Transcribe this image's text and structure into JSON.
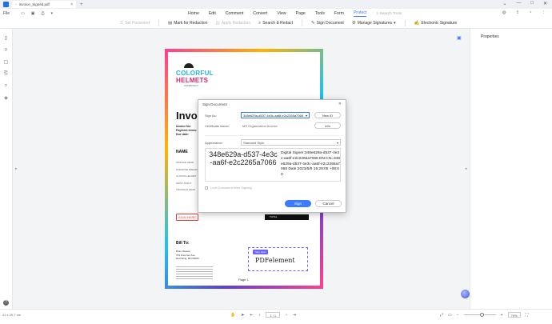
{
  "titlebar": {
    "tab_title": "invoice_Signed.pdf",
    "close_glyph": "×",
    "add_tab_glyph": "+",
    "window_controls": [
      "⌄",
      "—",
      "□",
      "✕"
    ]
  },
  "menubar": {
    "file_label": "File",
    "items": [
      "Home",
      "Edit",
      "Comment",
      "Convert",
      "View",
      "Page",
      "Tools",
      "Form",
      "Protect"
    ],
    "active_index": 8,
    "search_placeholder": "Search Tools"
  },
  "toolbar": {
    "items": [
      {
        "label": "Set Password",
        "disabled": true,
        "icon": "lock-icon"
      },
      {
        "label": "Mark for Redaction",
        "disabled": false,
        "icon": "redact-icon"
      },
      {
        "label": "Apply Redaction",
        "disabled": true,
        "icon": "apply-redaction-icon"
      },
      {
        "label": "Search & Redact",
        "disabled": false,
        "icon": "search-redact-icon"
      },
      {
        "label": "Sign Document",
        "disabled": false,
        "icon": "sign-icon"
      },
      {
        "label": "Manage Signatures",
        "disabled": false,
        "icon": "manage-signatures-icon"
      },
      {
        "label": "Electronic Signature",
        "disabled": false,
        "icon": "esign-icon"
      }
    ]
  },
  "properties": {
    "title": "Properties"
  },
  "page": {
    "brand_line1": "COLORFUL",
    "brand_line2": "HELMETS",
    "brand_line3": "COMPANY",
    "invoice_title": "Invo",
    "meta_lines": [
      "Invoice No:",
      "Payment terms:",
      "Due date:"
    ],
    "name_heading": "NAME",
    "name_rows": [
      "ORANGE HEAD",
      "PARADISE DREAM",
      "CLOUDS HELMET",
      "SHINY NIGHT",
      "TRIANGLE HEAD"
    ],
    "sign_here_tag": "SIGN HERE",
    "total_label": "TOTAL",
    "bill_to": "Bill To:",
    "bill_lines": [
      "Brian Weaver",
      "763 Freeman Ave",
      "Red Wing, MN 55066"
    ],
    "sig_tag": "Sign Here",
    "sig_text": "PDFelement",
    "page_label": "Page 1"
  },
  "dialog": {
    "title": "Sign Document",
    "sign_as_label": "Sign As:",
    "sign_as_value": "348e629a-d537-4e3c-aa6f-e2c2265a7066",
    "new_id_label": "New ID",
    "certificate_issuer_label": "Certificate Issuer:",
    "certificate_issuer_value": "MS Organization Access",
    "info_label": "Info",
    "appearance_label": "Appearance:",
    "appearance_value": "Standard Style",
    "preview_name": "348e629a-d537-4e3c-aa6f-e2c2265a7066",
    "preview_details": "Digital Signer:348e629a-d537-4e3c-aa6f-e2c2265a7066 DN:CN=348e629a-d537-4e3c-aa6f-e2c2265a7066 Date:2023/5/9 15:29:05 +08:00",
    "lock_label": "Lock Document After Signing",
    "sign_button": "Sign",
    "cancel_button": "Cancel"
  },
  "statusbar": {
    "dimensions": "21 x 29.7 cm",
    "page_input": "1 / 1",
    "zoom": "70%"
  }
}
